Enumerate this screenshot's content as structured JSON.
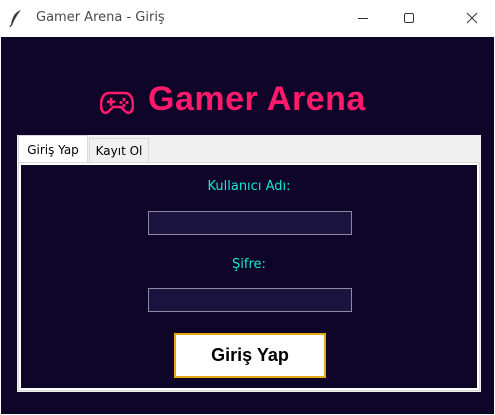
{
  "window": {
    "title": "Gamer Arena - Giriş",
    "controls": [
      "minimize-icon",
      "maximize-icon",
      "close-icon"
    ]
  },
  "header": {
    "title": "Gamer Arena",
    "icon": "gamepad-icon",
    "title_color": "#ff1a6b"
  },
  "tabs": [
    {
      "label": "Giriş Yap",
      "selected": true
    },
    {
      "label": "Kayıt Ol",
      "selected": false
    }
  ],
  "form": {
    "username_label": "Kullanıcı Adı:",
    "username_value": "",
    "password_label": "Şifre:",
    "password_value": "",
    "submit_label": "Giriş Yap"
  },
  "colors": {
    "background": "#0f0528",
    "label": "#17e8d2",
    "input_bg": "#1c1440",
    "button_border": "#e6a817"
  }
}
